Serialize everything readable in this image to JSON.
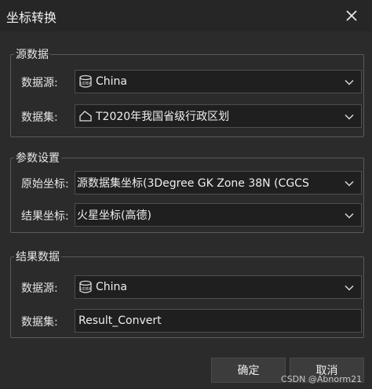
{
  "window": {
    "title": "坐标转换",
    "close_icon": "close-icon"
  },
  "source_group": {
    "legend": "源数据",
    "datasource": {
      "label": "数据源:",
      "value": "China",
      "icon": "udbx-datasource-icon"
    },
    "dataset": {
      "label": "数据集:",
      "value": "T2020年我国省级行政区划",
      "icon": "region-dataset-icon"
    }
  },
  "params_group": {
    "legend": "参数设置",
    "original_coord": {
      "label": "原始坐标:",
      "value": "源数据集坐标(3Degree GK Zone 38N    (CGCS"
    },
    "result_coord": {
      "label": "结果坐标:",
      "value": "火星坐标(高德)"
    }
  },
  "result_group": {
    "legend": "结果数据",
    "datasource": {
      "label": "数据源:",
      "value": "China",
      "icon": "udbx-datasource-icon"
    },
    "dataset": {
      "label": "数据集:",
      "value": "Result_Convert"
    }
  },
  "buttons": {
    "ok": "确定",
    "cancel": "取消"
  },
  "watermark": "CSDN @Abnorm21",
  "colors": {
    "background": "#2b2b2b",
    "field": "#1f1f1f",
    "border": "#5a5a5a",
    "text": "#e6e6e6"
  }
}
